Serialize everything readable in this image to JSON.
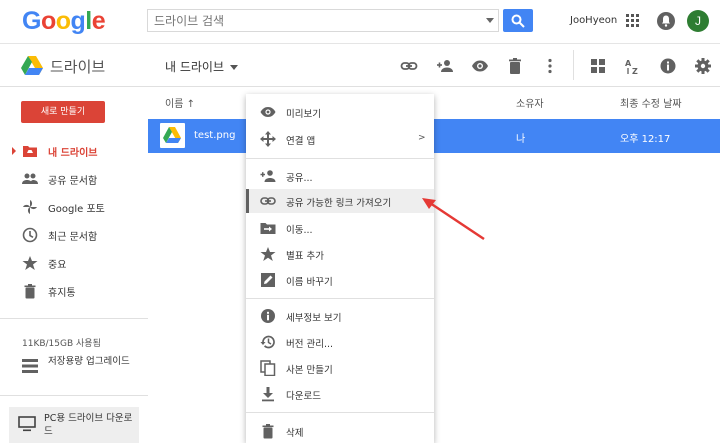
{
  "logo": {
    "text": "Google",
    "letters": [
      "G",
      "o",
      "o",
      "g",
      "l",
      "e"
    ],
    "colors": [
      "#4285f4",
      "#ea4335",
      "#fbbc05",
      "#4285f4",
      "#34a853",
      "#ea4335"
    ]
  },
  "search": {
    "placeholder": "드라이브 검색",
    "icon": "search-icon"
  },
  "header": {
    "user_name": "JooHyeon",
    "avatar_initial": "J",
    "avatar_color": "#2e7d32"
  },
  "subbar": {
    "app_title": "드라이브",
    "location": "내 드라이브",
    "toolbar_icons": [
      "link-icon",
      "add-person-icon",
      "eye-icon",
      "trash-icon",
      "more-vert-icon",
      "grid-view-icon",
      "sort-az-icon",
      "info-icon",
      "settings-icon"
    ]
  },
  "sidebar": {
    "new_button": "새로 만들기",
    "items": [
      {
        "label": "내 드라이브",
        "icon": "drive-folder-icon",
        "active": true
      },
      {
        "label": "공유 문서함",
        "icon": "people-icon",
        "active": false
      },
      {
        "label": "Google 포토",
        "icon": "pinwheel-icon",
        "active": false
      },
      {
        "label": "최근 문서함",
        "icon": "clock-icon",
        "active": false
      },
      {
        "label": "중요",
        "icon": "star-icon",
        "active": false
      },
      {
        "label": "휴지통",
        "icon": "trash-icon",
        "active": false
      }
    ],
    "storage": "11KB/15GB 사용됨",
    "upgrade": "저장용량 업그레이드",
    "pc_drive": "PC용 드라이브 다운로드"
  },
  "list": {
    "columns": {
      "name": "이름 ↑",
      "owner": "소유자",
      "modified": "최종 수정 날짜"
    },
    "rows": [
      {
        "name": "test.png",
        "owner": "나",
        "modified": "오후 12:17",
        "selected": true
      }
    ]
  },
  "context_menu": {
    "items": [
      {
        "label": "미리보기",
        "icon": "eye-icon"
      },
      {
        "label": "연결 앱",
        "icon": "move-arrows-icon",
        "submenu": ">"
      },
      {
        "label": "공유...",
        "icon": "add-person-icon"
      },
      {
        "label": "공유 가능한 링크 가져오기",
        "icon": "link-icon",
        "highlighted": true
      },
      {
        "label": "이동...",
        "icon": "move-folder-icon"
      },
      {
        "label": "별표 추가",
        "icon": "star-icon"
      },
      {
        "label": "이름 바꾸기",
        "icon": "edit-icon"
      },
      {
        "label": "세부정보 보기",
        "icon": "info-icon"
      },
      {
        "label": "버전 관리...",
        "icon": "history-icon"
      },
      {
        "label": "사본 만들기",
        "icon": "copy-icon"
      },
      {
        "label": "다운로드",
        "icon": "download-icon"
      },
      {
        "label": "삭제",
        "icon": "trash-icon"
      }
    ]
  },
  "colors": {
    "accent_blue": "#4285f4",
    "new_red": "#db4437",
    "annotation_red": "#e53935"
  }
}
